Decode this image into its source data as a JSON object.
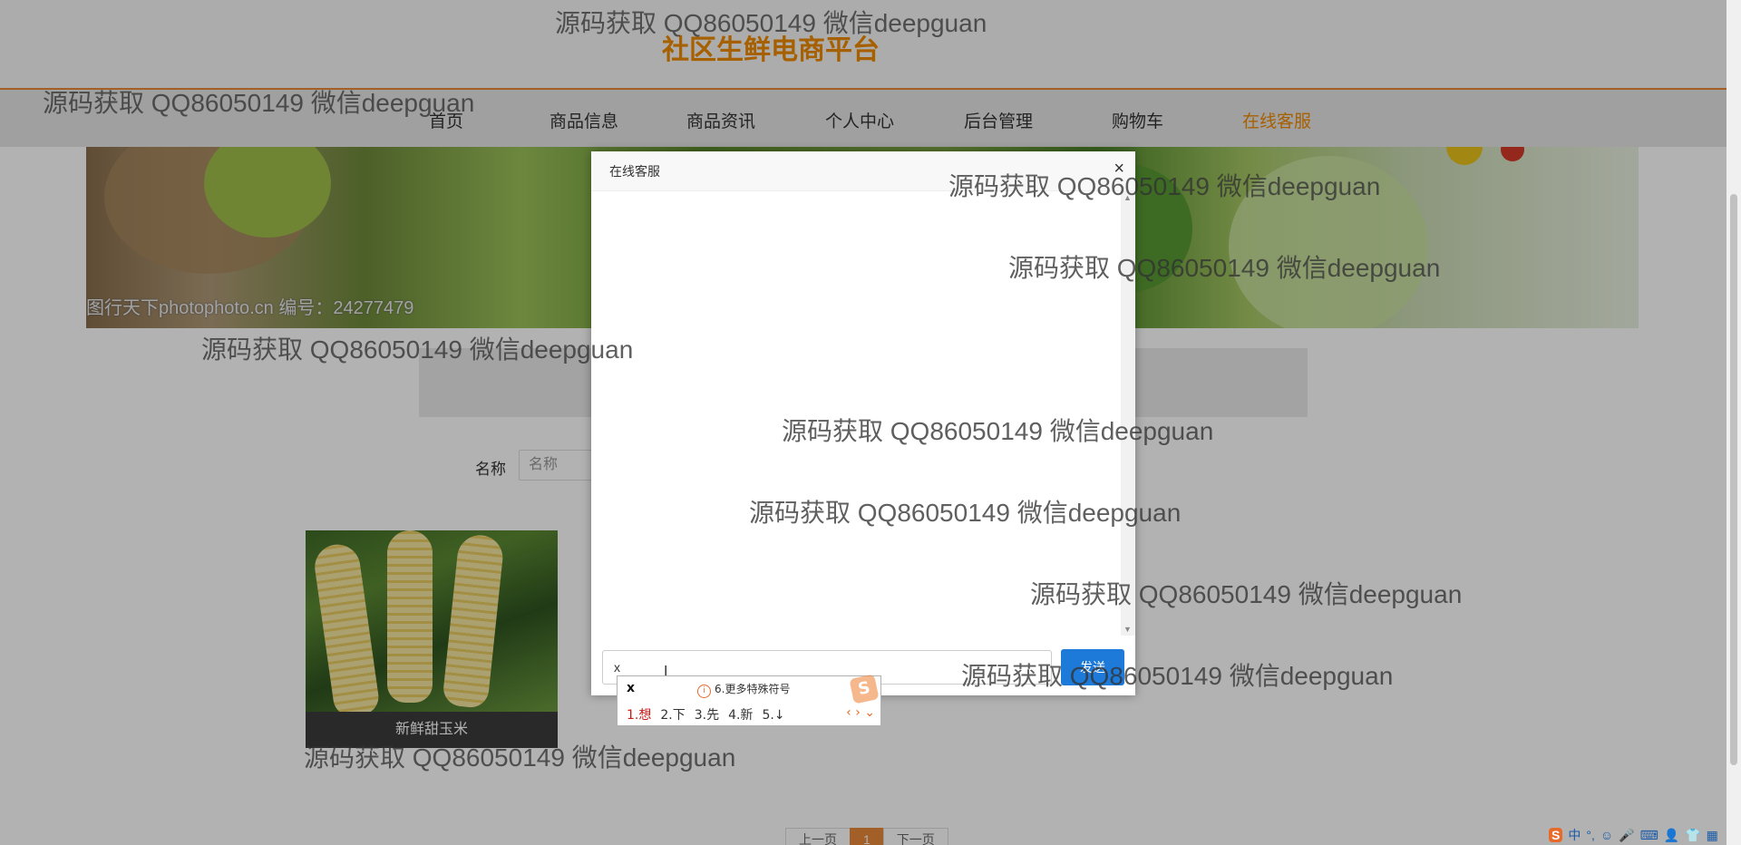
{
  "header": {
    "site_title": "社区生鲜电商平台"
  },
  "nav": {
    "items": [
      {
        "label": "首页"
      },
      {
        "label": "商品信息"
      },
      {
        "label": "商品资讯"
      },
      {
        "label": "个人中心"
      },
      {
        "label": "后台管理"
      },
      {
        "label": "购物车"
      },
      {
        "label": "在线客服",
        "active": true
      }
    ]
  },
  "banner": {
    "credit": "图行天下photophoto.cn 编号：24277479"
  },
  "search": {
    "label": "名称",
    "placeholder": "名称"
  },
  "products": [
    {
      "name": "新鲜甜玉米"
    }
  ],
  "pager": {
    "prev": "上一页",
    "current": "1",
    "next": "下一页"
  },
  "dialog": {
    "title": "在线客服",
    "close_glyph": "×",
    "input_value": "x",
    "send_label": "发送"
  },
  "ime": {
    "input": "x",
    "info_icon": "i",
    "info": "6.更多特殊符号",
    "logo": "S",
    "candidates": [
      "1.想",
      "2.下",
      "3.先",
      "4.新",
      "5.↓"
    ],
    "nav": "‹ › ⌄"
  },
  "tray": {
    "items": [
      "S",
      "中",
      "°,",
      "☺",
      "🎤",
      "⌨",
      "👤",
      "👕",
      "▦"
    ]
  },
  "watermark": {
    "text": "源码获取 QQ86050149 微信deepguan"
  },
  "colors": {
    "accent": "#f08a00",
    "send_button": "#1e7ad8"
  }
}
